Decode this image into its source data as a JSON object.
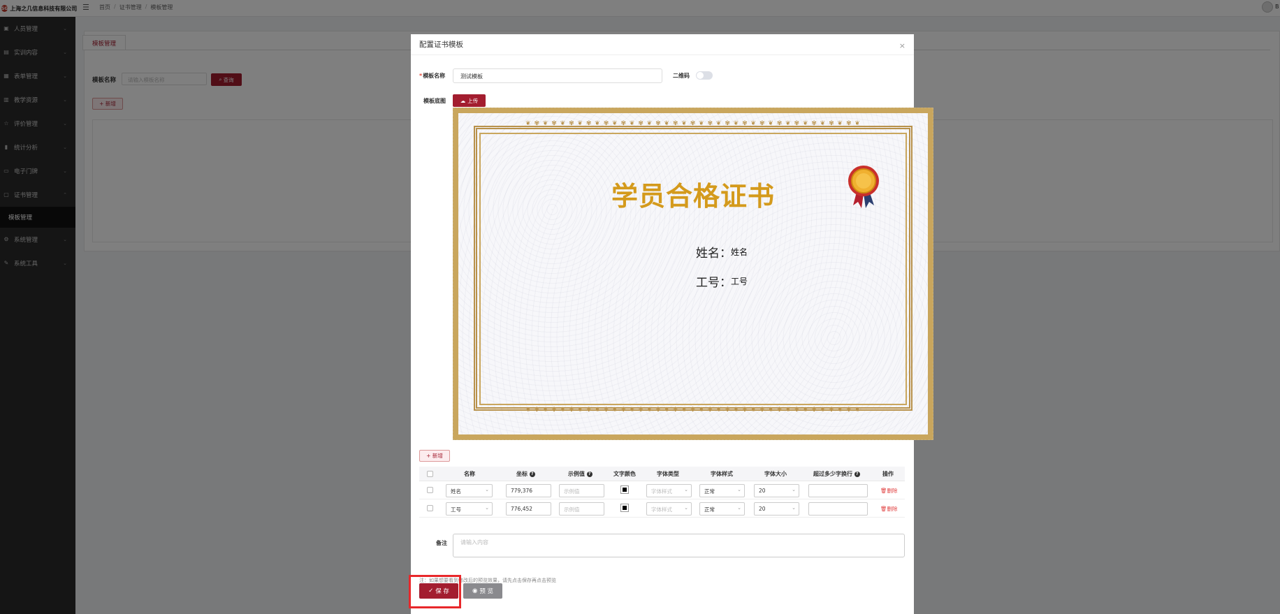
{
  "app": {
    "company": "上海之几信息科技有限公司",
    "logo_text": "SG",
    "menu_icon": "menu-fold-icon",
    "breadcrumb": [
      "首页",
      "证书管理",
      "模板管理"
    ],
    "user_initial": "B"
  },
  "sidebar": {
    "items": [
      {
        "label": "人员管理",
        "icon": "user-icon"
      },
      {
        "label": "实训内容",
        "icon": "book-icon"
      },
      {
        "label": "表单管理",
        "icon": "form-icon"
      },
      {
        "label": "教学资源",
        "icon": "folder-icon"
      },
      {
        "label": "评价管理",
        "icon": "star-icon"
      },
      {
        "label": "统计分析",
        "icon": "chart-icon"
      },
      {
        "label": "电子门牌",
        "icon": "monitor-icon"
      },
      {
        "label": "证书管理",
        "icon": "certificate-icon"
      }
    ],
    "active_sub": "模板管理",
    "items_after": [
      {
        "label": "系统管理",
        "icon": "gear-icon"
      },
      {
        "label": "系统工具",
        "icon": "tool-icon"
      }
    ]
  },
  "background": {
    "tab": "模板管理",
    "filter_label": "模板名称",
    "filter_placeholder": "请输入模板名称",
    "query_button": "查询",
    "add_button": "+ 新增"
  },
  "modal": {
    "title": "配置证书模板",
    "close": "×",
    "name_label": "模板名称",
    "name_value": "测试模板",
    "qrcode_label": "二维码",
    "qrcode_enabled": false,
    "image_label": "模板底图",
    "upload_button": "上传",
    "certificate": {
      "ornament": "❦ ✾ ❦ ✾ ❦ ✾ ❦ ✾ ❦ ✾ ❦ ✾ ❦ ✾ ❦ ✾ ❦ ✾ ❦ ✾ ❦ ✾ ❦ ✾ ❦ ✾ ❦ ✾ ❦ ✾ ❦ ✾ ❦ ✾ ❦ ✾ ❦ ✾ ❦",
      "title": "学员合格证书",
      "name_label": "姓名：",
      "name_value": "姓名",
      "id_label": "工号：",
      "id_value": "工号"
    },
    "add_button": "+ 新增",
    "table": {
      "headers": [
        "名称",
        "坐标",
        "示例值",
        "文字颜色",
        "字体类型",
        "字体样式",
        "字体大小",
        "超过多少字换行",
        "操作"
      ],
      "help_mark": "?",
      "rows": [
        {
          "name": "姓名",
          "coord": "779,376",
          "sample_placeholder": "示例值",
          "color": "#000000",
          "font_type_placeholder": "字体样式",
          "font_style": "正常",
          "font_size": "20",
          "wrap": "",
          "action": "删除"
        },
        {
          "name": "工号",
          "coord": "776,452",
          "sample_placeholder": "示例值",
          "color": "#000000",
          "font_type_placeholder": "字体样式",
          "font_style": "正常",
          "font_size": "20",
          "wrap": "",
          "action": "删除"
        }
      ]
    },
    "remark_label": "备注",
    "remark_placeholder": "请输入内容",
    "note": "注：如果想要看到修改后的预览效果，请先点击保存再点击预览",
    "save_button": "保 存",
    "preview_button": "预 览"
  }
}
